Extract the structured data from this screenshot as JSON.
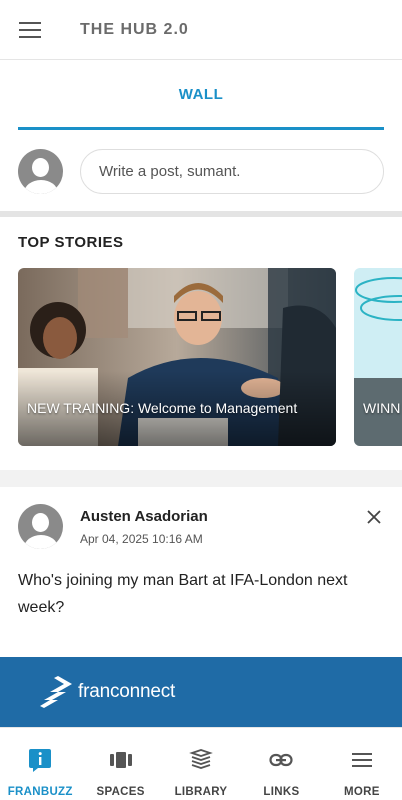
{
  "header": {
    "title": "THE HUB 2.0"
  },
  "tabs": [
    {
      "label": "WALL",
      "active": true
    }
  ],
  "composer": {
    "placeholder": "Write a post, sumant."
  },
  "top_stories": {
    "title": "TOP STORIES",
    "items": [
      {
        "caption": "NEW TRAINING: Welcome to Management"
      },
      {
        "caption": "WINN"
      }
    ]
  },
  "post": {
    "author": "Austen Asadorian",
    "date": "Apr 04, 2025 10:16 AM",
    "body": "Who's joining my man Bart at IFA-London next week?"
  },
  "banner": {
    "brand": "franconnect"
  },
  "bottom_nav": [
    {
      "label": "FRANBUZZ",
      "icon": "franbuzz-icon",
      "active": true
    },
    {
      "label": "SPACES",
      "icon": "spaces-icon",
      "active": false
    },
    {
      "label": "LIBRARY",
      "icon": "library-icon",
      "active": false
    },
    {
      "label": "LINKS",
      "icon": "links-icon",
      "active": false
    },
    {
      "label": "MORE",
      "icon": "more-icon",
      "active": false
    }
  ],
  "colors": {
    "accent": "#1a90c8",
    "banner": "#1f6ba6",
    "text": "#222222"
  }
}
